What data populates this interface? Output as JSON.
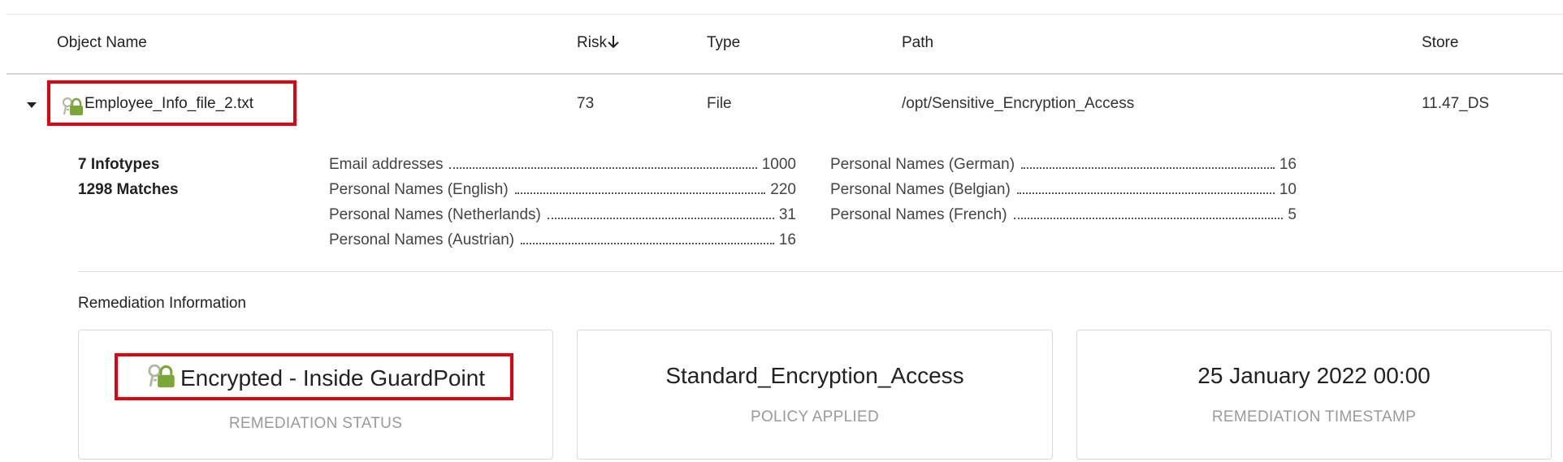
{
  "table": {
    "headers": {
      "object_name": "Object Name",
      "risk": "Risk",
      "type": "Type",
      "path": "Path",
      "store": "Store"
    },
    "sort_icon": "arrow-down-icon",
    "row": {
      "object_name": "Employee_Info_file_2.txt",
      "risk": "73",
      "type": "File",
      "path": "/opt/Sensitive_Encryption_Access",
      "store": "11.47_DS",
      "icon": "encrypted-lock-icon"
    }
  },
  "details": {
    "infotypes": "7 Infotypes",
    "matches": "1298 Matches",
    "col1": [
      {
        "label": "Email addresses",
        "count": "1000"
      },
      {
        "label": "Personal Names (English)",
        "count": "220"
      },
      {
        "label": "Personal Names (Netherlands)",
        "count": "31"
      },
      {
        "label": "Personal Names (Austrian)",
        "count": "16"
      }
    ],
    "col2": [
      {
        "label": "Personal Names (German)",
        "count": "16"
      },
      {
        "label": "Personal Names (Belgian)",
        "count": "10"
      },
      {
        "label": "Personal Names (French)",
        "count": "5"
      }
    ]
  },
  "remediation": {
    "title": "Remediation Information",
    "cards": [
      {
        "value": "Encrypted - Inside GuardPoint",
        "label": "REMEDIATION STATUS",
        "icon": "encrypted-lock-icon"
      },
      {
        "value": "Standard_Encryption_Access",
        "label": "POLICY APPLIED"
      },
      {
        "value": "25 January 2022 00:00",
        "label": "REMEDIATION TIMESTAMP"
      }
    ]
  },
  "colors": {
    "highlight": "#e0000f",
    "lock": "#7aa63a",
    "key": "#b6b6a0"
  }
}
